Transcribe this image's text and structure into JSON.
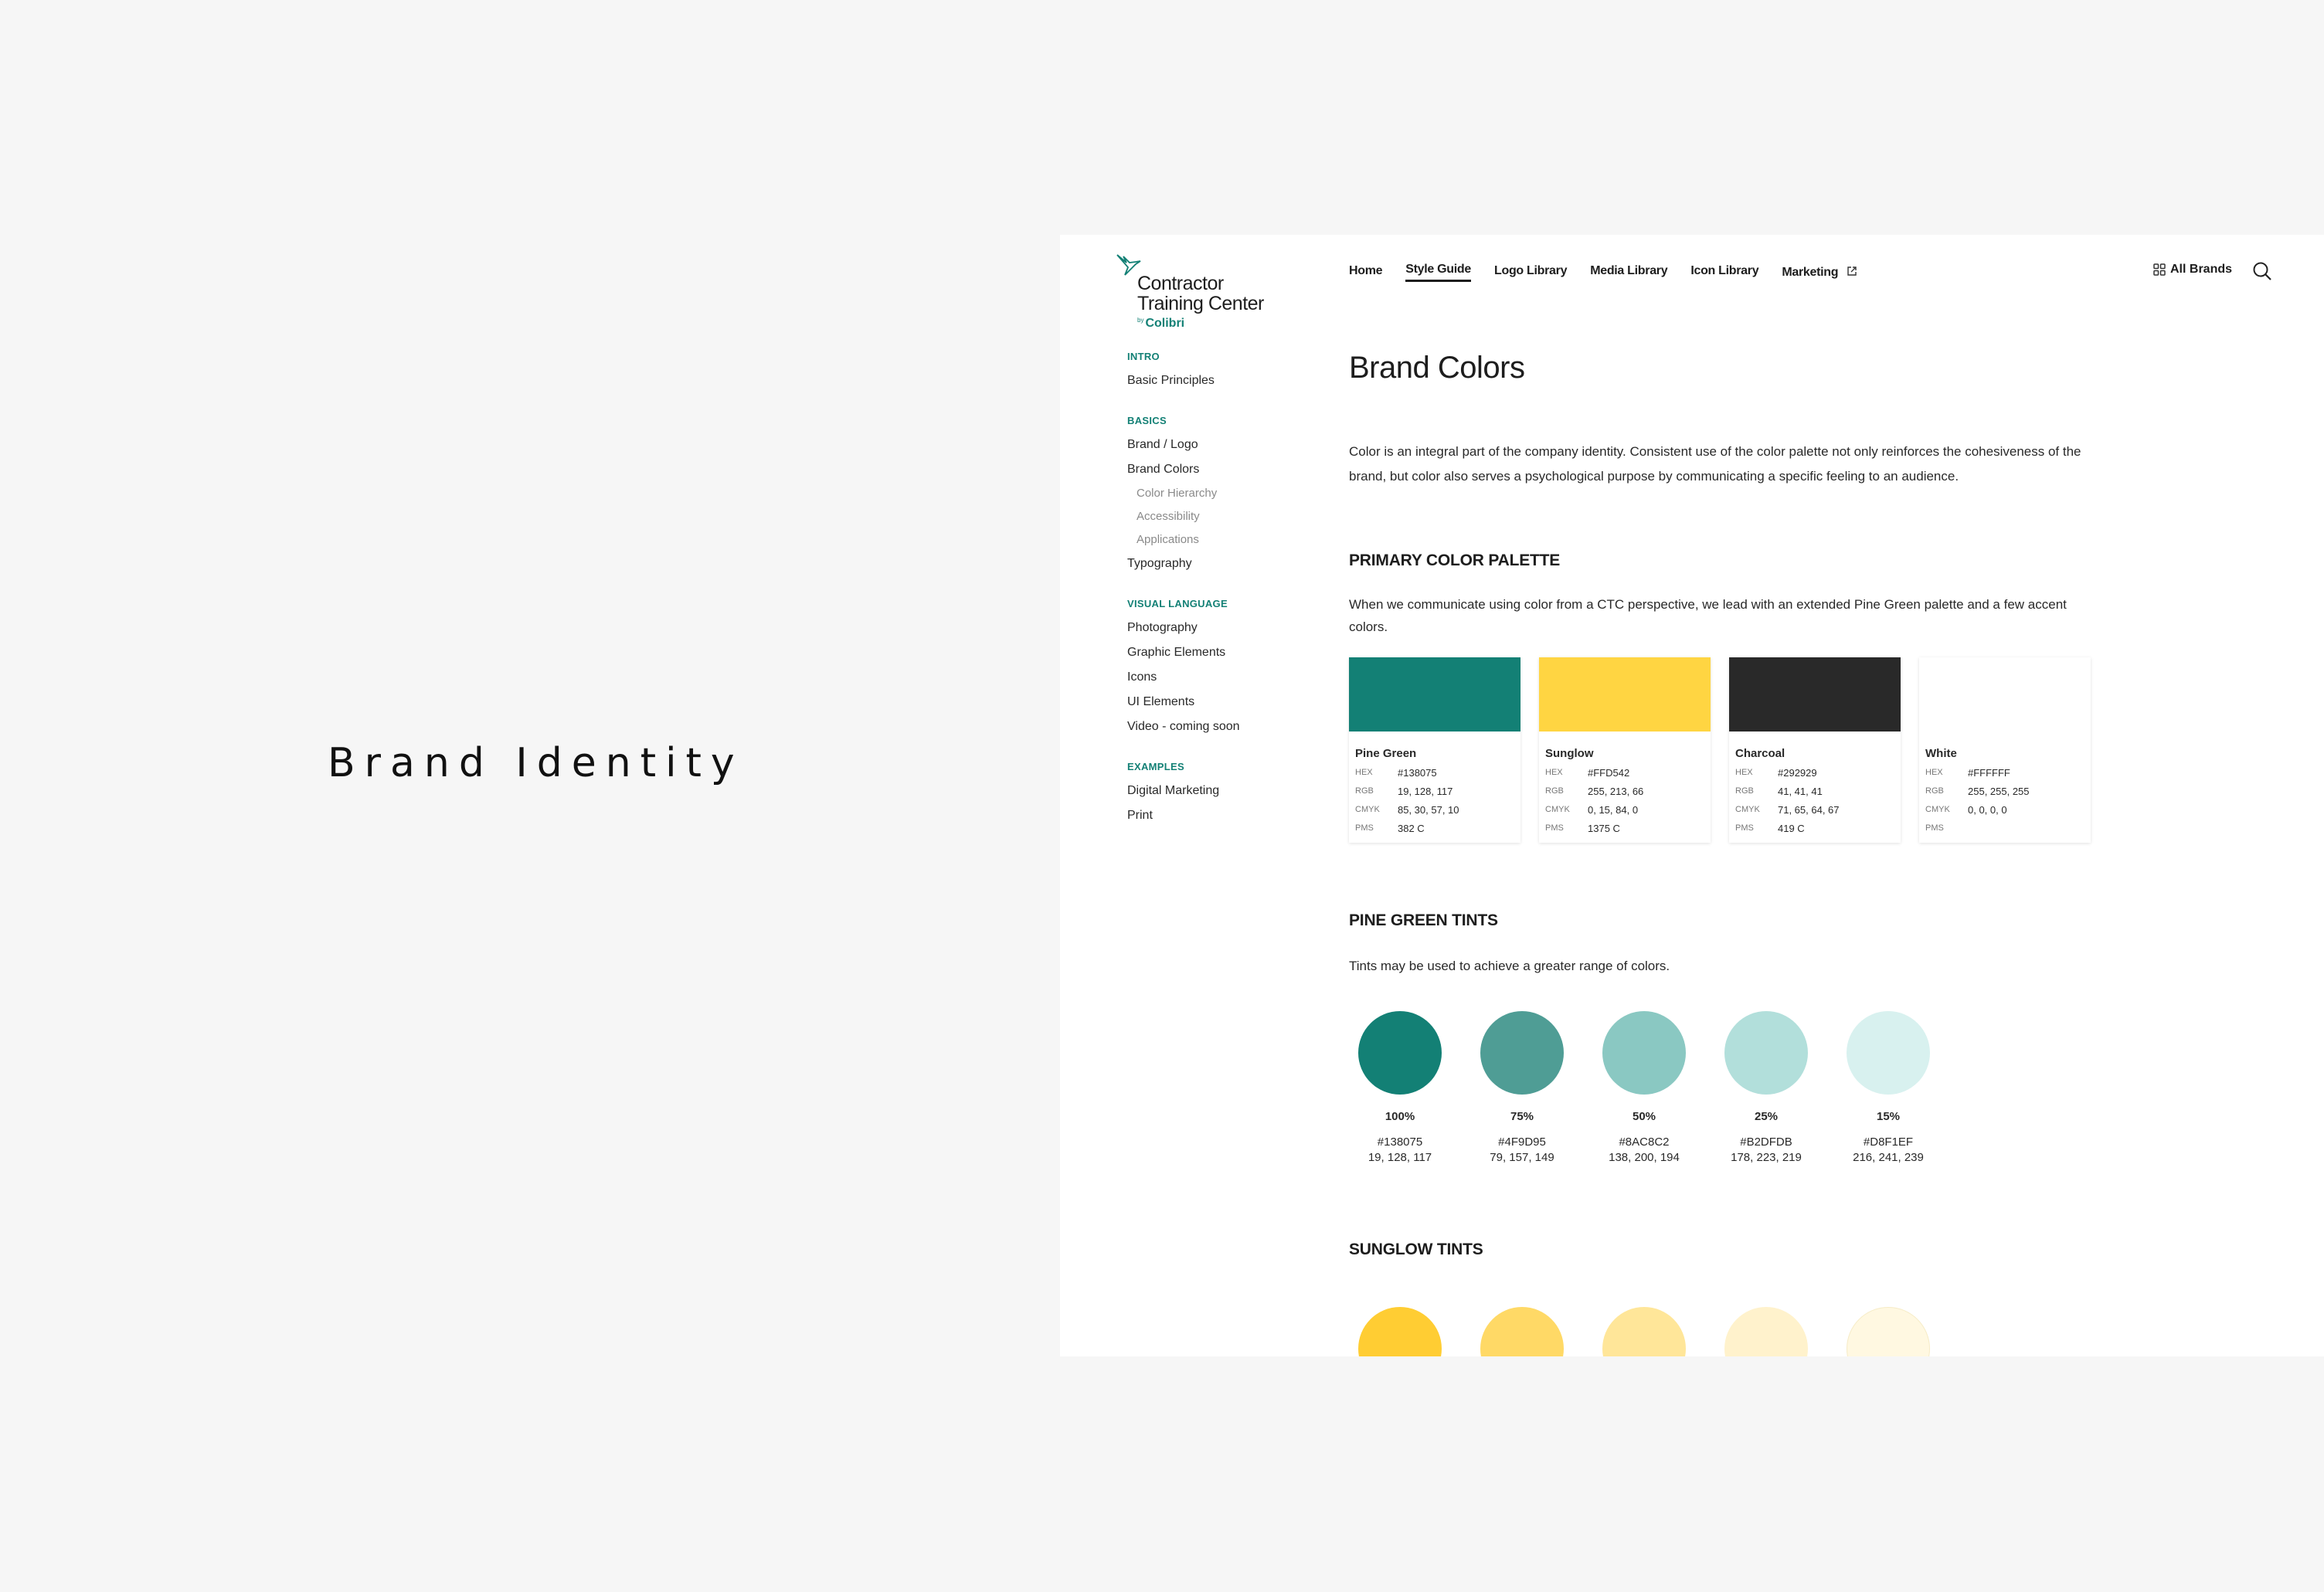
{
  "slide": {
    "title": "Brand Identity"
  },
  "logo": {
    "line1": "Contractor",
    "line2": "Training Center",
    "by": "by",
    "brand": "Colibri"
  },
  "nav": {
    "items": [
      {
        "label": "Home",
        "active": false
      },
      {
        "label": "Style Guide",
        "active": true
      },
      {
        "label": "Logo Library",
        "active": false
      },
      {
        "label": "Media Library",
        "active": false
      },
      {
        "label": "Icon Library",
        "active": false
      },
      {
        "label": "Marketing",
        "active": false,
        "external": true
      }
    ],
    "all_brands": "All Brands",
    "search_icon": "search-icon"
  },
  "sidebar": {
    "sections": [
      {
        "label": "INTRO",
        "items": [
          {
            "label": "Basic Principles"
          }
        ]
      },
      {
        "label": "BASICS",
        "items": [
          {
            "label": "Brand / Logo"
          },
          {
            "label": "Brand Colors",
            "subitems": [
              {
                "label": "Color Hierarchy"
              },
              {
                "label": "Accessibility"
              },
              {
                "label": "Applications"
              }
            ]
          },
          {
            "label": "Typography"
          }
        ]
      },
      {
        "label": "VISUAL LANGUAGE",
        "items": [
          {
            "label": "Photography"
          },
          {
            "label": "Graphic Elements"
          },
          {
            "label": "Icons"
          },
          {
            "label": "UI Elements"
          },
          {
            "label": "Video - coming soon"
          }
        ]
      },
      {
        "label": "EXAMPLES",
        "items": [
          {
            "label": "Digital Marketing"
          },
          {
            "label": "Print"
          }
        ]
      }
    ]
  },
  "main": {
    "title": "Brand Colors",
    "intro": "Color is an integral part of the company identity. Consistent use of the color palette not only reinforces the cohesiveness of the brand, but color also serves a psychological purpose by communicating a specific feeling to an audience.",
    "primary": {
      "heading": "PRIMARY COLOR PALETTE",
      "text": "When we communicate using color from a CTC perspective, we lead with an extended Pine Green palette and a few accent colors.",
      "labels": {
        "hex": "HEX",
        "rgb": "RGB",
        "cmyk": "CMYK",
        "pms": "PMS"
      },
      "colors": [
        {
          "name": "Pine Green",
          "hex": "#138075",
          "rgb": "19, 128, 117",
          "cmyk": "85, 30, 57, 10",
          "pms": "382 C",
          "swatch": "#138075"
        },
        {
          "name": "Sunglow",
          "hex": "#FFD542",
          "rgb": "255, 213, 66",
          "cmyk": "0, 15, 84, 0",
          "pms": "1375 C",
          "swatch": "#FFD542"
        },
        {
          "name": "Charcoal",
          "hex": "#292929",
          "rgb": "41, 41, 41",
          "cmyk": "71, 65, 64, 67",
          "pms": "419 C",
          "swatch": "#292929"
        },
        {
          "name": "White",
          "hex": "#FFFFFF",
          "rgb": "255, 255, 255",
          "cmyk": "0, 0, 0, 0",
          "pms": "",
          "swatch": "#FFFFFF"
        }
      ]
    },
    "pine_tints": {
      "heading": "PINE GREEN TINTS",
      "text": "Tints may be used to achieve a greater range of colors.",
      "tints": [
        {
          "pct": "100%",
          "hex": "#138075",
          "rgb": "19, 128, 117"
        },
        {
          "pct": "75%",
          "hex": "#4F9D95",
          "rgb": "79, 157, 149"
        },
        {
          "pct": "50%",
          "hex": "#8AC8C2",
          "rgb": "138, 200, 194"
        },
        {
          "pct": "25%",
          "hex": "#B2DFDB",
          "rgb": "178, 223, 219"
        },
        {
          "pct": "15%",
          "hex": "#D8F1EF",
          "rgb": "216, 241, 239"
        }
      ]
    },
    "sunglow_tints": {
      "heading": "SUNGLOW TINTS",
      "swatches": [
        "#FFCD33",
        "#FFD966",
        "#FFE699",
        "#FFF2CC",
        "#FFF8E1"
      ]
    }
  }
}
